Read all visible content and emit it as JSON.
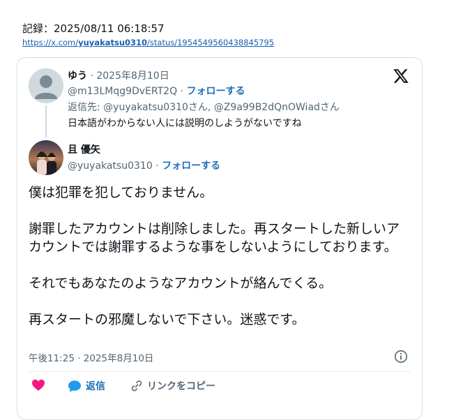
{
  "record": {
    "label": "記録：2025/08/11 06:18:57",
    "url_prefix": "https://x.com/",
    "url_user": "yuyakatsu0310",
    "url_suffix": "/status/1954549560438845795"
  },
  "parent_tweet": {
    "name": "ゆう",
    "date": " · 2025年8月10日",
    "handle": "@m13LMqg9DvERT2Q · ",
    "follow": "フォローする",
    "reply_to": "返信先: @yuyakatsu0310さん, @Z9a99B2dQnOWiadさん",
    "text": "日本語がわからない人には説明のしようがないですね"
  },
  "main_tweet": {
    "name": "且 優矢",
    "handle": "@yuyakatsu0310 · ",
    "follow": "フォローする",
    "paragraphs": [
      "僕は犯罪を犯しておりません。",
      "謝罪したアカウントは削除しました。再スタートした新しいアカウントでは謝罪するような事をしないようにしております。",
      "それでもあなたのようなアカウントが絡んでくる。",
      "再スタートの邪魔しないで下さい。迷惑です。"
    ],
    "timestamp": "午後11:25 · 2025年8月10日"
  },
  "actions": {
    "reply": "返信",
    "copy_link": "リンクをコピー"
  },
  "colors": {
    "link_blue": "#1d6fb8",
    "heart_pink": "#f91880",
    "reply_blue": "#1d9bf0",
    "muted_text": "#536471"
  },
  "icons": [
    "x-logo-icon",
    "info-icon",
    "heart-icon",
    "reply-bubble-icon",
    "link-icon"
  ]
}
